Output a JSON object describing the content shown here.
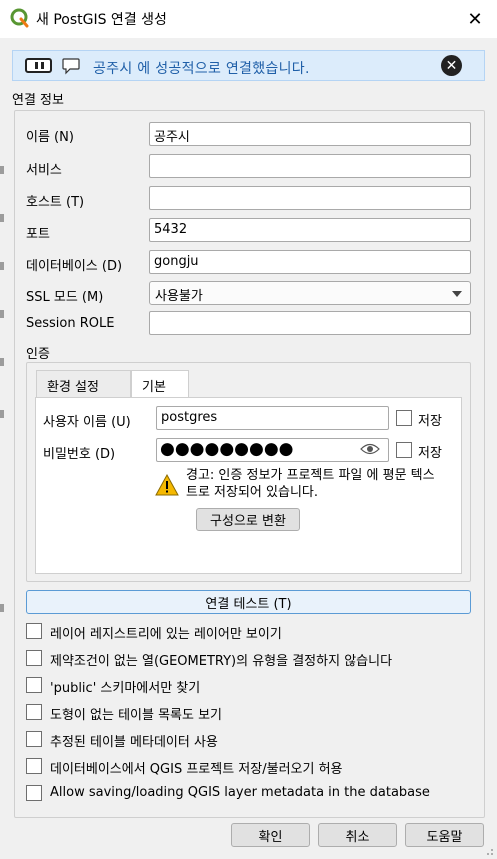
{
  "window": {
    "title": "새 PostGIS 연결 생성",
    "close_glyph": "✕"
  },
  "message_bar": {
    "text": "공주시 에 성공적으로 연결했습니다.",
    "close_glyph": "✕"
  },
  "section_title": "연결 정보",
  "fields": {
    "name": {
      "label": "이름 (N)",
      "value": "공주시"
    },
    "service": {
      "label": "서비스",
      "value": ""
    },
    "host": {
      "label": "호스트 (T)",
      "value": ""
    },
    "port": {
      "label": "포트",
      "value": "5432"
    },
    "database": {
      "label": "데이터베이스 (D)",
      "value": "gongju"
    },
    "ssl": {
      "label": "SSL 모드 (M)",
      "value": "사용불가"
    },
    "session_role": {
      "label": "Session ROLE",
      "value": ""
    }
  },
  "auth": {
    "label": "인증",
    "tabs": [
      {
        "label": "환경 설정"
      },
      {
        "label": "기본"
      }
    ],
    "active_tab": "기본",
    "username": {
      "label": "사용자 이름 (U)",
      "value": "postgres",
      "store_label": "저장"
    },
    "password": {
      "label": "비밀번호 (D)",
      "masked": "●●●●●●●●●",
      "store_label": "저장"
    },
    "warning_text": "경고: 인증 정보가 프로젝트 파일 에 평문 텍스트로 저장되어 있습니다.",
    "convert_button": "구성으로 변환"
  },
  "test_button": "연결 테스트 (T)",
  "options": [
    {
      "label": "레이어 레지스트리에 있는 레이어만 보이기",
      "checked": false
    },
    {
      "label": "제약조건이 없는 열(GEOMETRY)의 유형을 결정하지 않습니다",
      "checked": false
    },
    {
      "label": "'public' 스키마에서만 찾기",
      "checked": false
    },
    {
      "label": "도형이 없는 테이블 목록도 보기",
      "checked": false
    },
    {
      "label": "추정된 테이블 메타데이터 사용",
      "checked": false
    },
    {
      "label": "데이터베이스에서 QGIS 프로젝트 저장/불러오기 허용",
      "checked": false
    },
    {
      "label": "Allow saving/loading QGIS layer metadata in the database",
      "checked": false
    }
  ],
  "buttons": {
    "ok": "확인",
    "cancel": "취소",
    "help": "도움말"
  },
  "colors": {
    "message_bg": "#dcecfb",
    "message_text": "#1f5fa8",
    "qgis_green": "#589632",
    "qgis_yellow": "#ee7913"
  }
}
